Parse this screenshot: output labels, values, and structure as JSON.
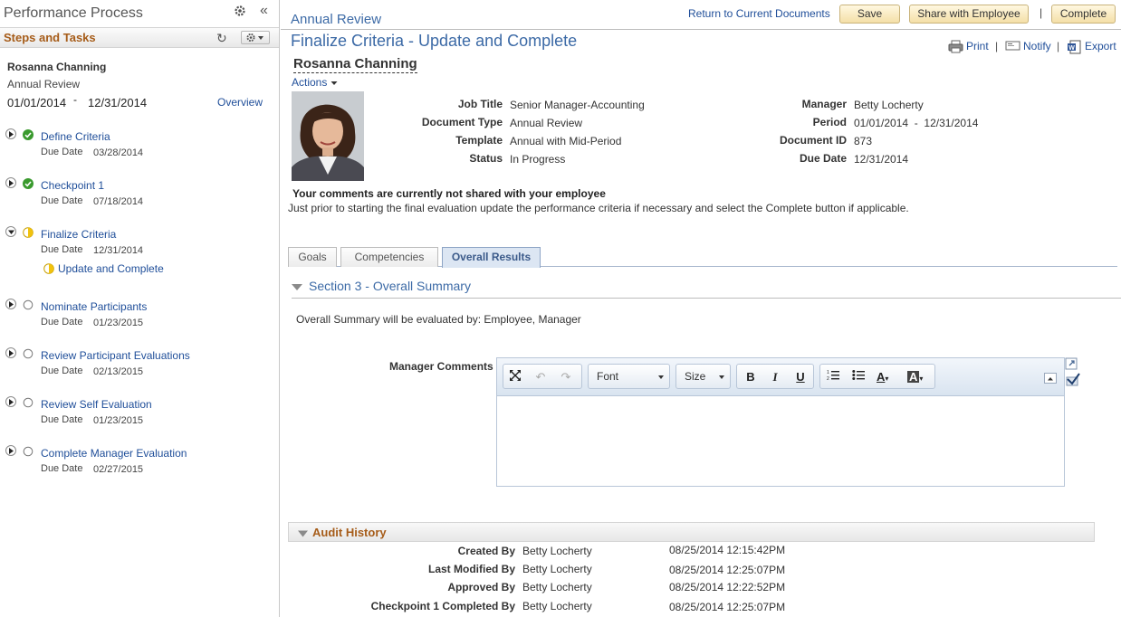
{
  "left_panel": {
    "title": "Performance Process",
    "steps_title": "Steps and Tasks",
    "employee_name": "Rosanna Channing",
    "document_type": "Annual Review",
    "period_start": "01/01/2014",
    "period_dash": "-",
    "period_end": "12/31/2014",
    "overview_label": "Overview",
    "due_label": "Due Date",
    "steps": [
      {
        "name": "Define Criteria",
        "due": "03/28/2014",
        "status": "complete"
      },
      {
        "name": "Checkpoint 1",
        "due": "07/18/2014",
        "status": "complete"
      },
      {
        "name": "Finalize Criteria",
        "due": "12/31/2014",
        "status": "in-progress"
      },
      {
        "name": "Nominate Participants",
        "due": "01/23/2015",
        "status": "not-started"
      },
      {
        "name": "Review Participant Evaluations",
        "due": "02/13/2015",
        "status": "not-started"
      },
      {
        "name": "Review Self Evaluation",
        "due": "01/23/2015",
        "status": "not-started"
      },
      {
        "name": "Complete Manager Evaluation",
        "due": "02/27/2015",
        "status": "not-started"
      }
    ],
    "sub_step": "Update and Complete"
  },
  "header": {
    "document_label": "Annual Review",
    "return_link": "Return to Current Documents",
    "save_label": "Save",
    "share_label": "Share with Employee",
    "separator": "|",
    "complete_label": "Complete"
  },
  "page": {
    "title": "Finalize Criteria - Update and Complete",
    "print_label": "Print",
    "notify_label": "Notify",
    "export_label": "Export",
    "tool_separator": "|",
    "employee_name": "Rosanna Channing",
    "actions_label": "Actions"
  },
  "details": {
    "job_title_label": "Job Title",
    "job_title": "Senior Manager-Accounting",
    "doc_type_label": "Document Type",
    "doc_type": "Annual Review",
    "template_label": "Template",
    "template": "Annual with Mid-Period",
    "status_label": "Status",
    "status": "In Progress",
    "manager_label": "Manager",
    "manager": "Betty Locherty",
    "period_label": "Period",
    "period": "01/01/2014  -  12/31/2014",
    "doc_id_label": "Document ID",
    "doc_id": "873",
    "due_date_label": "Due Date",
    "due_date": "12/31/2014"
  },
  "notice": {
    "bold": "Your comments are currently not shared with your employee",
    "text": "Just prior to starting the final evaluation update the performance criteria if necessary and select the Complete button if applicable."
  },
  "tabs": [
    {
      "label": "Goals"
    },
    {
      "label": "Competencies"
    },
    {
      "label": "Overall Results"
    }
  ],
  "section": {
    "title": "Section 3 - Overall Summary",
    "evaluated_by": "Overall Summary will be evaluated by: Employee, Manager",
    "comments_label": "Manager Comments"
  },
  "editor": {
    "font_label": "Font",
    "size_label": "Size",
    "bold": "B",
    "italic": "I",
    "underline": "U",
    "text_color": "A",
    "bg_color": "A"
  },
  "audit": {
    "title": "Audit History",
    "rows": [
      {
        "label": "Created By",
        "user": "Betty Locherty",
        "time": "08/25/2014 12:15:42PM"
      },
      {
        "label": "Last Modified By",
        "user": "Betty Locherty",
        "time": "08/25/2014 12:25:07PM"
      },
      {
        "label": "Approved By",
        "user": "Betty Locherty",
        "time": "08/25/2014 12:22:52PM"
      },
      {
        "label": "Checkpoint 1 Completed By",
        "user": "Betty Locherty",
        "time": "08/25/2014 12:25:07PM"
      }
    ]
  },
  "colors": {
    "link": "#1f4e99",
    "heading": "#3c6aa6",
    "section_orange": "#a65c19",
    "complete_green": "#3a9a2e",
    "progress_yellow": "#f1c20e"
  }
}
